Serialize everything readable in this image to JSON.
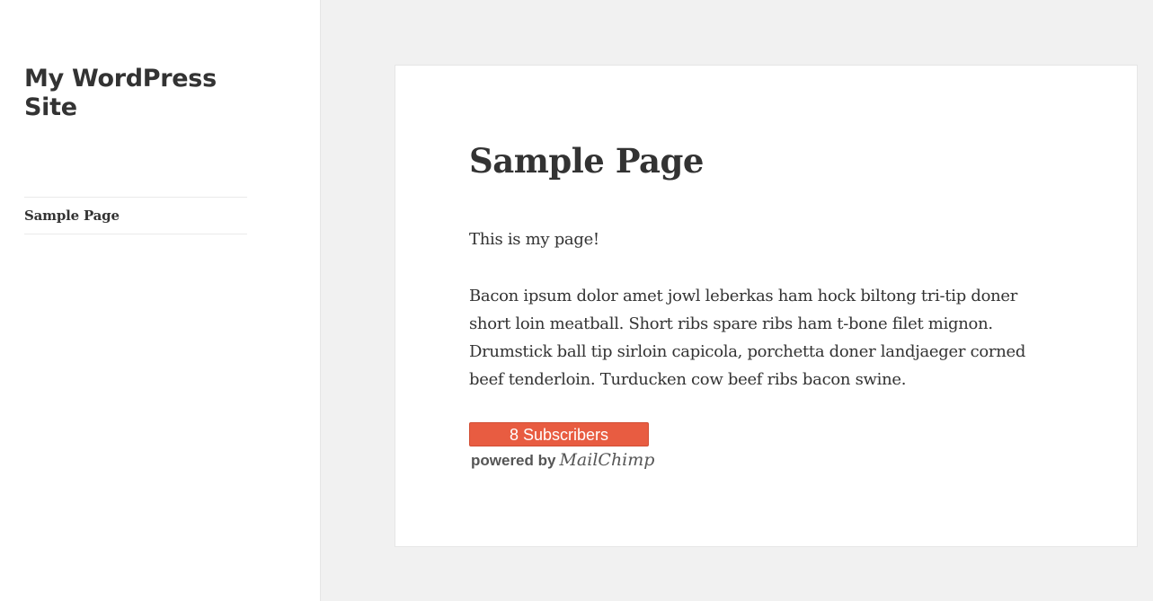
{
  "site": {
    "title": "My WordPress Site"
  },
  "nav": {
    "items": [
      {
        "label": "Sample Page"
      }
    ]
  },
  "page": {
    "title": "Sample Page",
    "paragraphs": [
      "This is my page!",
      "Bacon ipsum dolor amet jowl leberkas ham hock biltong tri-tip doner short loin meatball. Short ribs spare ribs ham t-bone filet mignon. Drumstick ball tip sirloin capicola, porchetta doner landjaeger corned beef tenderloin. Turducken cow beef ribs bacon swine."
    ]
  },
  "mailchimp": {
    "button_label": "8 Subscribers",
    "powered_prefix": "powered by",
    "brand": "MailChimp",
    "button_color": "#e85c41"
  }
}
